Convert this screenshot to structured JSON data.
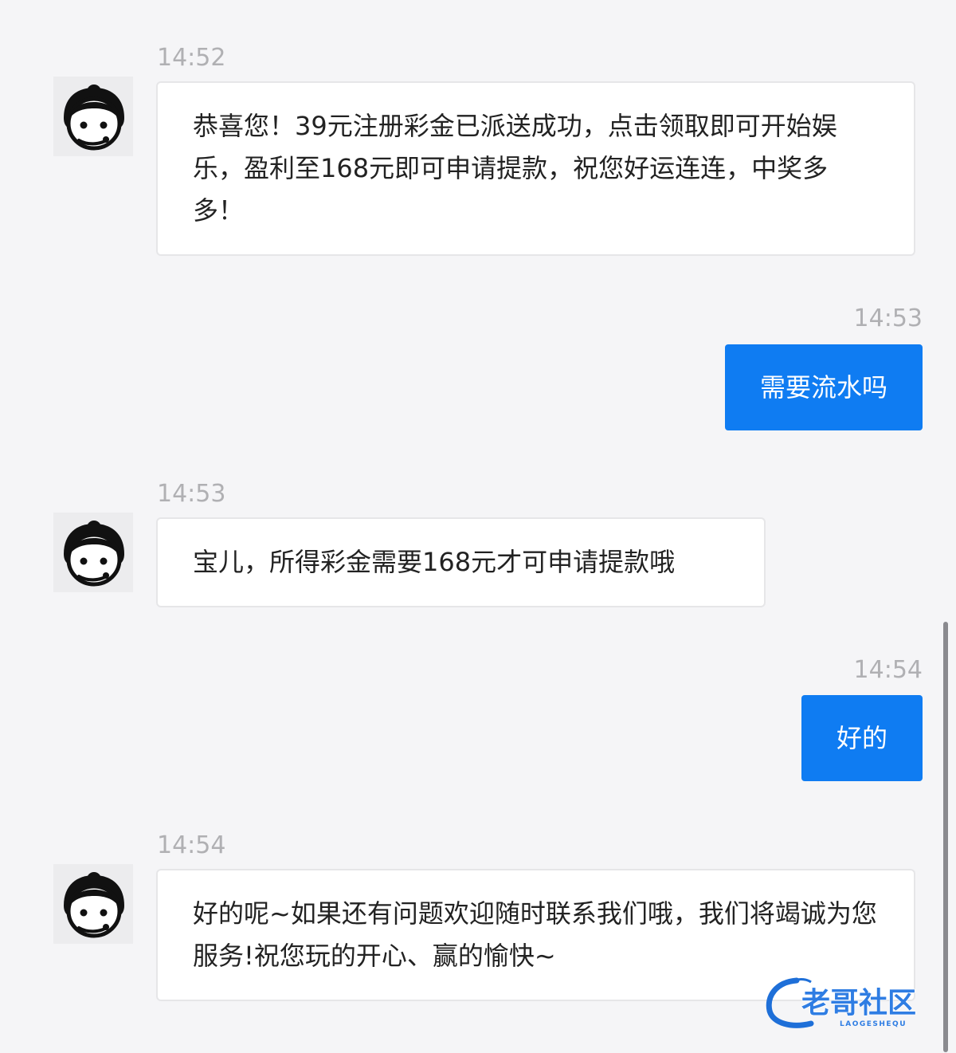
{
  "messages": [
    {
      "sender": "agent",
      "time": "14:52",
      "text": "恭喜您！39元注册彩金已派送成功，点击领取即可开始娱乐，盈利至168元即可申请提款，祝您好运连连，中奖多多！"
    },
    {
      "sender": "user",
      "time": "14:53",
      "text": "需要流水吗"
    },
    {
      "sender": "agent",
      "time": "14:53",
      "text": "宝儿，所得彩金需要168元才可申请提款哦"
    },
    {
      "sender": "user",
      "time": "14:54",
      "text": "好的"
    },
    {
      "sender": "agent",
      "time": "14:54",
      "text": "好的呢~如果还有问题欢迎随时联系我们哦，我们将竭诚为您服务!祝您玩的开心、赢的愉快~"
    }
  ],
  "watermark": {
    "title": "老哥社区",
    "subtitle": "LAOGESHEQU"
  },
  "colors": {
    "user_bubble": "#0f7cf2",
    "agent_bubble": "#ffffff",
    "background": "#f5f5f7",
    "timestamp": "#b0b0b3"
  },
  "icons": {
    "agent_avatar": "customer-service-agent-icon"
  }
}
